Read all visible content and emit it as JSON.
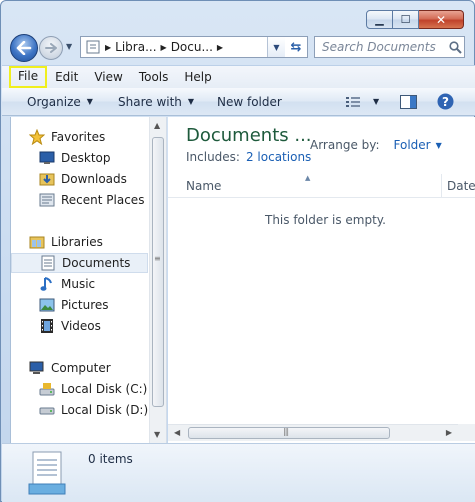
{
  "window": {
    "caption": {
      "minimize": "▁",
      "maximize": "☐",
      "close": "✕"
    }
  },
  "address": {
    "crumbs": [
      "Libra...",
      "Docu..."
    ],
    "search_placeholder": "Search Documents"
  },
  "menubar": {
    "items": [
      "File",
      "Edit",
      "View",
      "Tools",
      "Help"
    ],
    "highlighted": "File"
  },
  "toolbar": {
    "organize": "Organize",
    "share_with": "Share with",
    "new_folder": "New folder"
  },
  "nav": {
    "favorites": "Favorites",
    "desktop": "Desktop",
    "downloads": "Downloads",
    "recent_places": "Recent Places",
    "libraries": "Libraries",
    "documents": "Documents",
    "music": "Music",
    "pictures": "Pictures",
    "videos": "Videos",
    "computer": "Computer",
    "local_c": "Local Disk (C:)",
    "local_d": "Local Disk (D:)"
  },
  "content": {
    "title": "Documents ...",
    "includes_label": "Includes:",
    "includes_link": "2 locations",
    "arrange_label": "Arrange by:",
    "arrange_value": "Folder",
    "col_name": "Name",
    "col_date": "Date",
    "empty_message": "This folder is empty."
  },
  "details": {
    "item_count": "0 items"
  },
  "colors": {
    "accent_link": "#1a5fb4",
    "title_green": "#1e5a3c",
    "highlight_box": "#f0ef1e"
  }
}
